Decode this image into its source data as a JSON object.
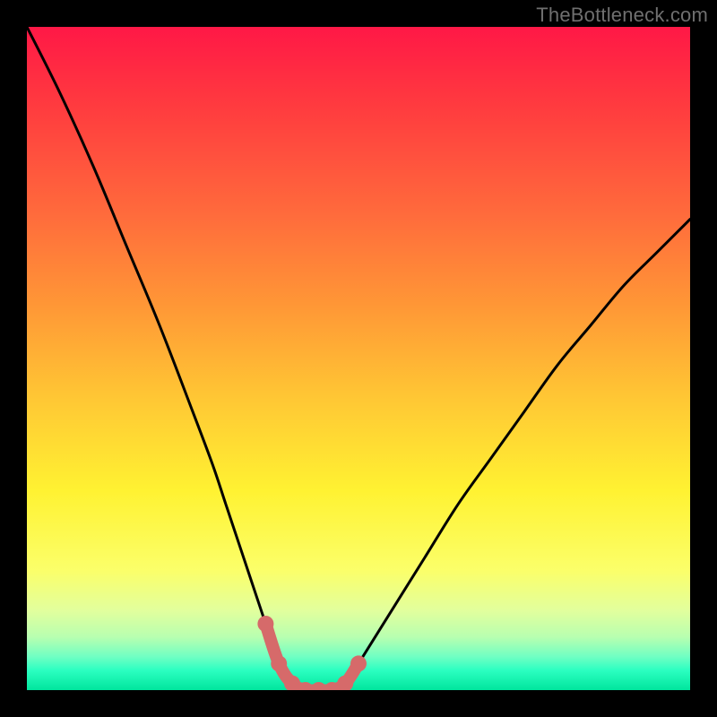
{
  "watermark": "TheBottleneck.com",
  "colors": {
    "background": "#000000",
    "curve": "#000000",
    "highlight": "#d66a6a"
  },
  "chart_data": {
    "type": "line",
    "title": "",
    "xlabel": "",
    "ylabel": "",
    "xlim": [
      0,
      100
    ],
    "ylim": [
      0,
      100
    ],
    "grid": false,
    "legend": false,
    "series": [
      {
        "name": "bottleneck-curve",
        "x": [
          0,
          5,
          10,
          15,
          20,
          25,
          28,
          30,
          32,
          34,
          36,
          38,
          40,
          42,
          44,
          46,
          48,
          50,
          55,
          60,
          65,
          70,
          75,
          80,
          85,
          90,
          95,
          100
        ],
        "values": [
          100,
          90,
          79,
          67,
          55,
          42,
          34,
          28,
          22,
          16,
          10,
          4,
          1,
          0,
          0,
          0,
          1,
          4,
          12,
          20,
          28,
          35,
          42,
          49,
          55,
          61,
          66,
          71
        ]
      },
      {
        "name": "optimal-range-highlight",
        "x": [
          36,
          38,
          40,
          42,
          44,
          46,
          48,
          50
        ],
        "values": [
          10,
          4,
          1,
          0,
          0,
          0,
          1,
          4
        ]
      }
    ],
    "annotations": []
  }
}
